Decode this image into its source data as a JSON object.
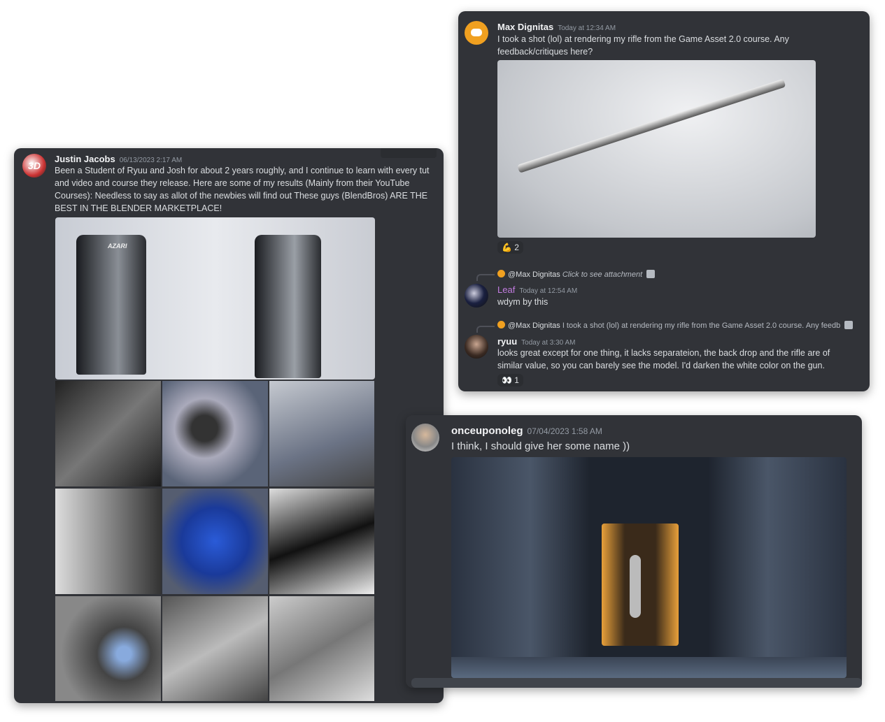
{
  "post1": {
    "author": "Justin Jacobs",
    "timestamp": "06/13/2023 2:17 AM",
    "text": "Been a Student of Ryuu and Josh for about 2 years roughly, and I continue to learn with every tut and video and course they release.  Here are some of my results (Mainly from their YouTube Courses):  Needless to say as allot of the newbies will find out These guys (BlendBros) ARE THE BEST IN THE BLENDER MARKETPLACE!",
    "avatar_text": "3D",
    "brand_text": "AZARI"
  },
  "post2": {
    "author": "Max Dignitas",
    "timestamp": "Today at 12:34 AM",
    "text": "I took a shot (lol) at rendering my rifle from the Game Asset 2.0 course. Any feedback/critiques here?",
    "reaction": {
      "icon": "flexed-biceps",
      "emoji": "💪",
      "count": "2"
    },
    "replies": [
      {
        "reply_to": "@Max Dignitas",
        "reply_preview": "Click to see attachment",
        "author": "Leaf",
        "author_color": "#c27ce0",
        "timestamp": "Today at 12:54 AM",
        "text": "wdym by this"
      },
      {
        "reply_to": "@Max Dignitas",
        "reply_preview": "I took a shot (lol) at rendering my rifle from the Game Asset 2.0 course. Any feedb",
        "author": "ryuu",
        "timestamp": "Today at 3:30 AM",
        "text": "looks great except for one thing, it lacks separateion, the back drop and the rifle are of similar value, so you can barely see the model. I'd darken the white color on the gun.",
        "reaction": {
          "icon": "eyes",
          "emoji": "👀",
          "count": "1"
        }
      }
    ]
  },
  "post3": {
    "author": "onceuponoleg",
    "timestamp": "07/04/2023 1:58 AM",
    "text": "I think, I should give her some name ))"
  }
}
